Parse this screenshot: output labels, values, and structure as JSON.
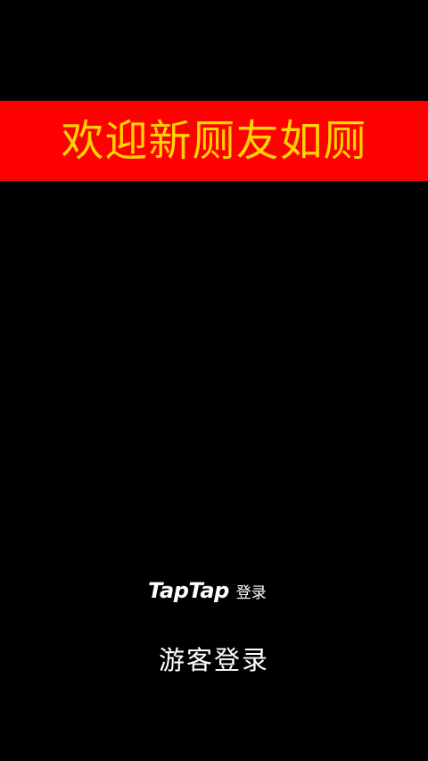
{
  "banner": {
    "text": "欢迎新厕友如厕",
    "background_color": "#ff0000",
    "text_color": "#ffd400"
  },
  "login": {
    "taptap_logo": "TapTap",
    "taptap_label": "登录",
    "guest_label": "游客登录"
  },
  "colors": {
    "background": "#000000",
    "text": "#ffffff"
  }
}
